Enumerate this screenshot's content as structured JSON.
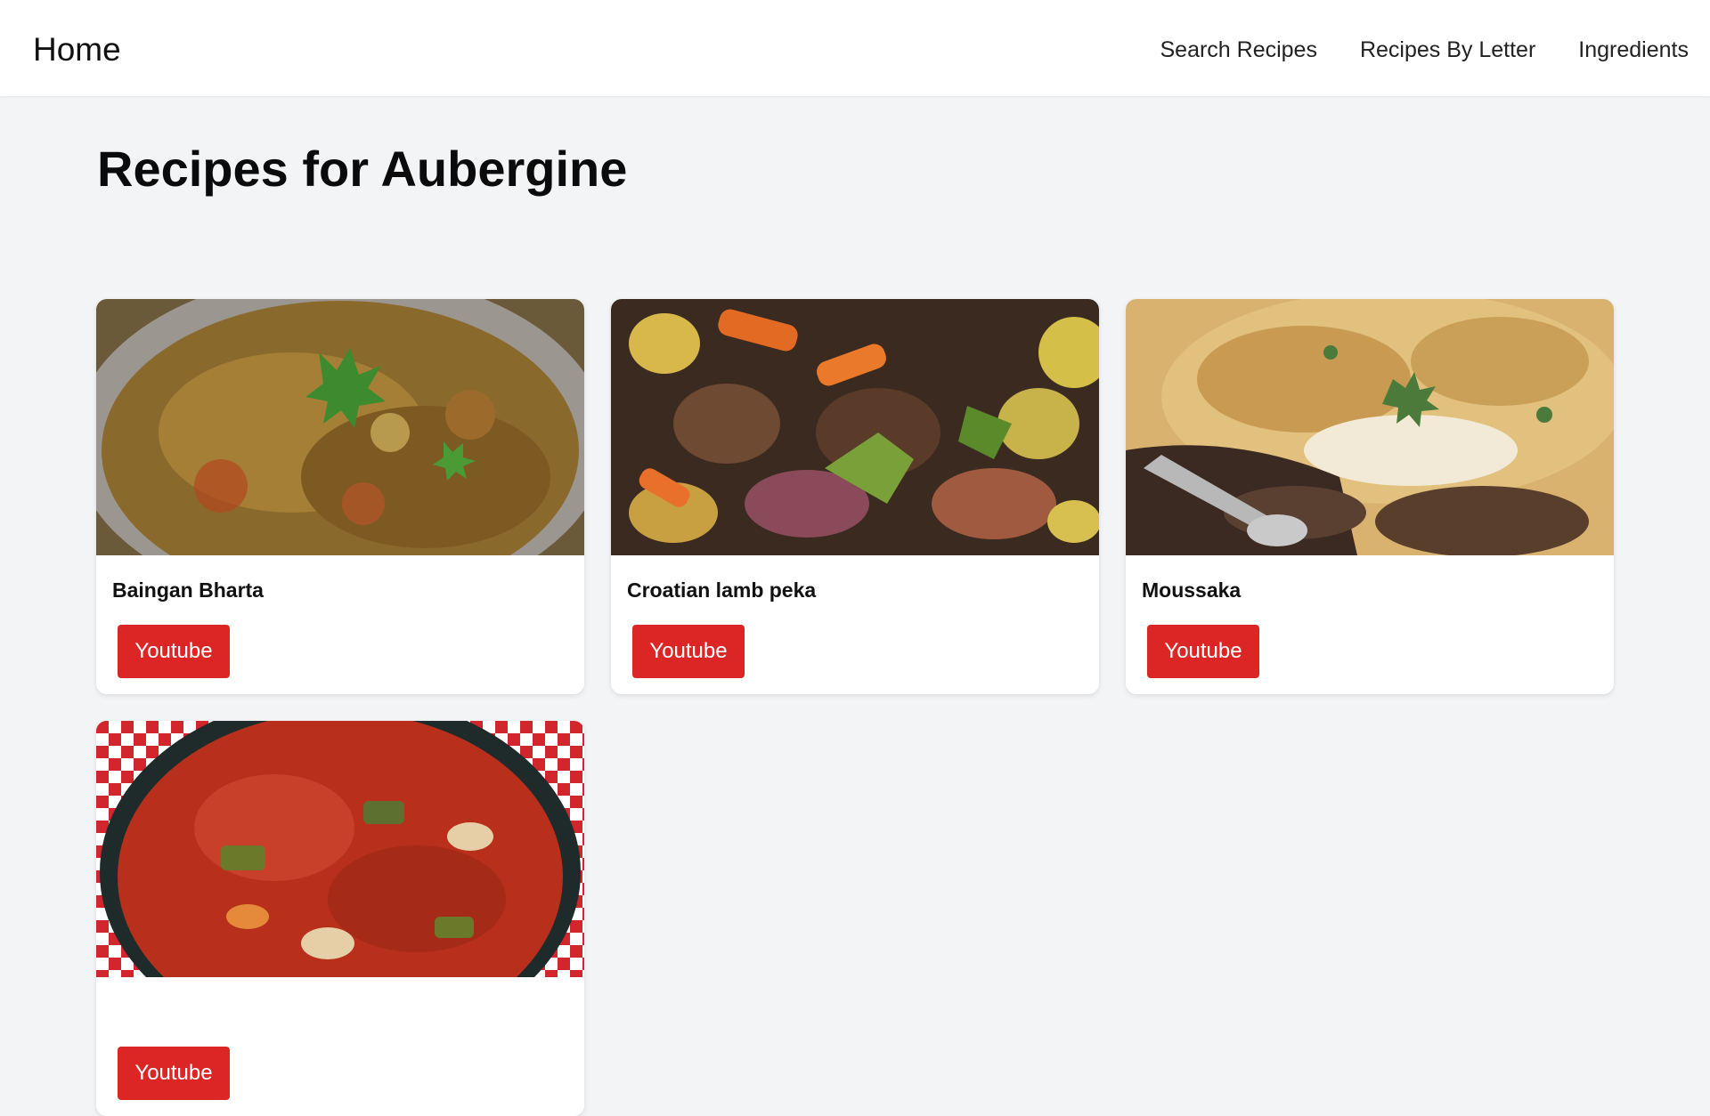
{
  "nav": {
    "home": "Home",
    "links": [
      "Search Recipes",
      "Recipes By Letter",
      "Ingredients"
    ]
  },
  "page": {
    "title": "Recipes for Aubergine"
  },
  "recipes": [
    {
      "name": "Baingan Bharta",
      "button": "Youtube"
    },
    {
      "name": "Croatian lamb peka",
      "button": "Youtube"
    },
    {
      "name": "Moussaka",
      "button": "Youtube"
    },
    {
      "name": "",
      "button": "Youtube"
    }
  ],
  "colors": {
    "background": "#f3f4f6",
    "navbar": "#ffffff",
    "youtube_button": "#dc2626"
  }
}
